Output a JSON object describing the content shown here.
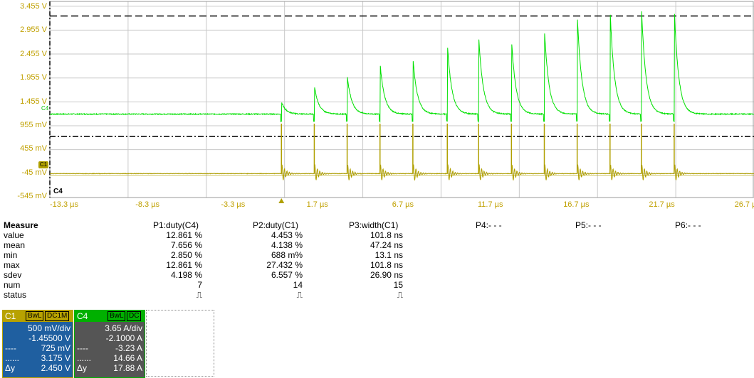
{
  "chart_data": {
    "type": "line",
    "y_ticks": [
      "3.455 V",
      "2.955 V",
      "2.455 V",
      "1.955 V",
      "1.455 V",
      "955 mV",
      "455 mV",
      "-45 mV",
      "-545 mV"
    ],
    "x_ticks": [
      "-13.3 µs",
      "-8.3 µs",
      "-3.3 µs",
      "1.7 µs",
      "6.7 µs",
      "11.7 µs",
      "16.7 µs",
      "21.7 µs",
      "26.7 µs"
    ],
    "x_tick_values": [
      -13.3,
      -8.3,
      -3.3,
      1.7,
      6.7,
      11.7,
      16.7,
      21.7,
      26.7
    ],
    "xlim": [
      -14.8,
      30.2
    ],
    "ylim": [
      -545,
      3555
    ],
    "trigger_time": 0,
    "cursor_levels_mV": [
      3250,
      730
    ],
    "series": [
      {
        "name": "C4",
        "color": "#00e000",
        "baseline_mV": 1200,
        "pulse_times": [
          0,
          2.1,
          4.2,
          6.3,
          8.4,
          10.6,
          12.6,
          14.7,
          16.8,
          18.9,
          21.0,
          23.0,
          25.1
        ],
        "pulse_peaks_mV": [
          1450,
          1800,
          2020,
          2290,
          2390,
          2700,
          2870,
          2780,
          3030,
          3330,
          3410,
          3500,
          3440
        ]
      },
      {
        "name": "C1",
        "color": "#b0a000",
        "baseline_mV": -45,
        "pulse_times": [
          0,
          2.1,
          4.2,
          6.3,
          8.4,
          10.6,
          12.6,
          14.7,
          16.8,
          18.9,
          21.0,
          23.0,
          25.1
        ],
        "pulse_peaks_mV": [
          1000,
          1000,
          1000,
          1000,
          1000,
          1000,
          1000,
          1000,
          1000,
          1000,
          1000,
          1000,
          1000
        ]
      }
    ]
  },
  "channel_tags": {
    "c4": "C4",
    "c1": "C1",
    "c4_bottom": "C4"
  },
  "measure": {
    "title": "Measure",
    "params": [
      "P1:duty(C4)",
      "P2:duty(C1)",
      "P3:width(C1)",
      "P4:- - -",
      "P5:- - -",
      "P6:- - -"
    ],
    "rows": [
      {
        "label": "value",
        "cells": [
          "12.861 %",
          "4.453 %",
          "101.8 ns"
        ]
      },
      {
        "label": "mean",
        "cells": [
          "7.656 %",
          "4.138 %",
          "47.24 ns"
        ]
      },
      {
        "label": "min",
        "cells": [
          "2.850 %",
          "688 m%",
          "13.1 ns"
        ]
      },
      {
        "label": "max",
        "cells": [
          "12.861 %",
          "27.432 %",
          "101.8 ns"
        ]
      },
      {
        "label": "sdev",
        "cells": [
          "4.198 %",
          "6.557 %",
          "26.90 ns"
        ]
      },
      {
        "label": "num",
        "cells": [
          "7",
          "14",
          "15"
        ]
      },
      {
        "label": "status",
        "cells": [
          "⎍",
          "⎍",
          "⎍"
        ]
      }
    ]
  },
  "panel_c1": {
    "name": "C1",
    "badge1": "BwL",
    "badge2": "DC1M",
    "vdiv": "500 mV/div",
    "offset": "-1.45500 V",
    "cur1_sym": "----",
    "cur1": "725 mV",
    "cur2_sym": "......",
    "cur2": "3.175 V",
    "dy_sym": "Δy",
    "dy": "2.450 V",
    "colors": {
      "head": "#b8a200",
      "body": "#1f5fa0"
    }
  },
  "panel_c4": {
    "name": "C4",
    "badge1": "BwL",
    "badge2": "DC",
    "vdiv": "3.65 A/div",
    "offset": "-2.1000 A",
    "cur1_sym": "----",
    "cur1": "-3.23 A",
    "cur2_sym": "......",
    "cur2": "14.66 A",
    "dy_sym": "Δy",
    "dy": "17.88 A",
    "colors": {
      "head": "#00b000",
      "body": "#555555"
    }
  }
}
